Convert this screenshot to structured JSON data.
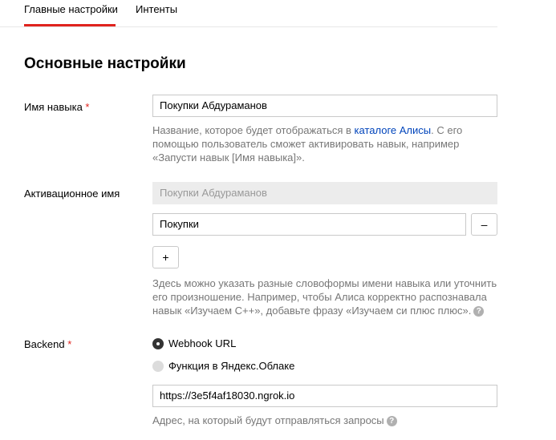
{
  "tabs": {
    "main": "Главные настройки",
    "intents": "Интенты"
  },
  "section_title": "Основные настройки",
  "skill_name": {
    "label": "Имя навыка",
    "required_mark": "*",
    "value": "Покупки Абдураманов",
    "hint_prefix": "Название, которое будет отображаться в ",
    "hint_link": "каталоге Алисы",
    "hint_suffix": ". С его помощью пользователь сможет активировать навык, например «Запусти навык [Имя навыка]»."
  },
  "activation_name": {
    "label": "Активационное имя",
    "disabled_value": "Покупки Абдураманов",
    "value": "Покупки",
    "remove_label": "–",
    "add_label": "+",
    "hint": "Здесь можно указать разные словоформы имени навыка или уточнить его произношение. Например, чтобы Алиса корректно распознавала навык «Изучаем С++», добавьте фразу «Изучаем си плюс плюс»."
  },
  "backend": {
    "label": "Backend",
    "required_mark": "*",
    "option_webhook": "Webhook URL",
    "option_function": "Функция в Яндекс.Облаке",
    "selected": "Webhook URL",
    "url_value": "https://3e5f4af18030.ngrok.io",
    "hint": "Адрес, на который будут отправляться запросы"
  },
  "help_glyph": "?",
  "colors": {
    "accent": "#e0231e",
    "link": "#0044bb",
    "hint": "#777777"
  }
}
